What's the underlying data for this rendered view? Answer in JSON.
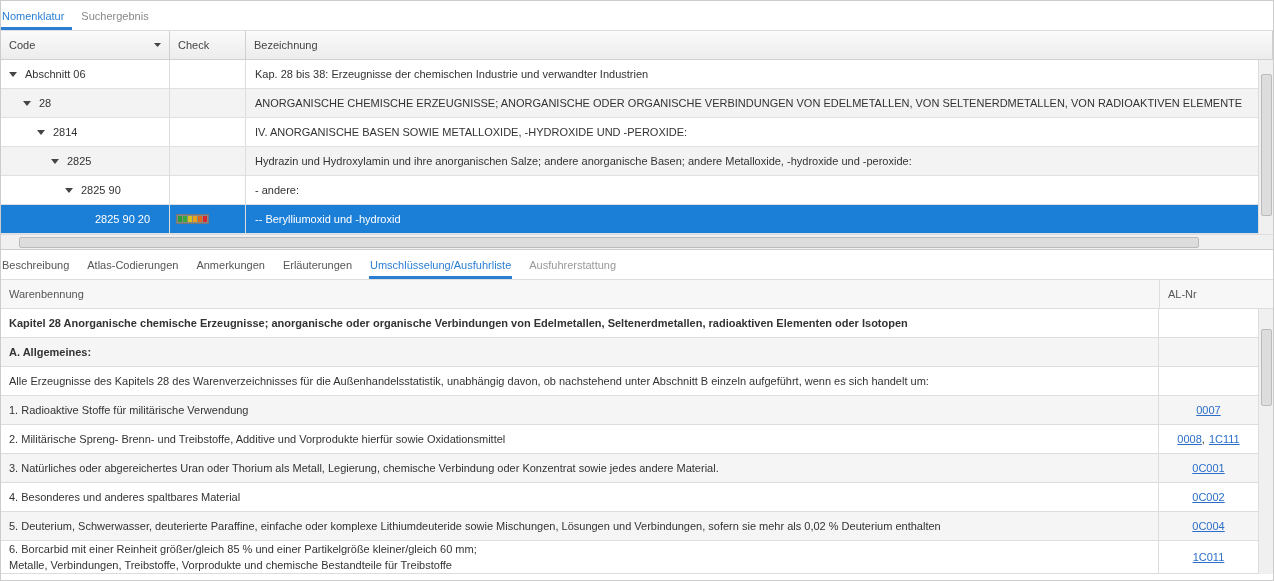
{
  "top_tabs": [
    {
      "label": "Nomenklatur",
      "selected": true
    },
    {
      "label": "Suchergebnis",
      "selected": false
    }
  ],
  "tree_columns": [
    "Code",
    "Check",
    "Bezeichnung"
  ],
  "tree": [
    {
      "code": "Abschnitt 06",
      "expanded": true,
      "selected": false,
      "description": "Kap. 28 bis 38: Erzeugnisse der chemischen Industrie und verwandter Industrien",
      "children": [
        {
          "code": "28",
          "expanded": true,
          "selected": false,
          "description": "ANORGANISCHE CHEMISCHE ERZEUGNISSE; ANORGANISCHE ODER ORGANISCHE VERBINDUNGEN VON EDELMETALLEN, VON SELTENERDMETALLEN, VON RADIOAKTIVEN ELEMENTE",
          "children": [
            {
              "code": "2814",
              "expanded": true,
              "selected": false,
              "description": "IV. ANORGANISCHE BASEN SOWIE METALLOXIDE, -HYDROXIDE UND -PEROXIDE:",
              "children": [
                {
                  "code": "2825",
                  "expanded": true,
                  "selected": false,
                  "description": "Hydrazin und Hydroxylamin und ihre anorganischen Salze; andere anorganische Basen; andere Metalloxide, -hydroxide und -peroxide:",
                  "children": [
                    {
                      "code": "2825 90",
                      "expanded": true,
                      "selected": false,
                      "description": "- andere:",
                      "children": [
                        {
                          "code": "2825 90 20",
                          "selected": true,
                          "meter": true,
                          "description": "-- Berylliumoxid und -hydroxid"
                        }
                      ]
                    }
                  ]
                }
              ]
            }
          ]
        }
      ]
    }
  ],
  "detail_tabs": [
    {
      "label": "Beschreibung",
      "selected": false,
      "disabled": false
    },
    {
      "label": "Atlas-Codierungen",
      "selected": false,
      "disabled": false
    },
    {
      "label": "Anmerkungen",
      "selected": false,
      "disabled": false
    },
    {
      "label": "Erläuterungen",
      "selected": false,
      "disabled": false
    },
    {
      "label": "Umschlüsselung/Ausfuhrliste",
      "selected": true,
      "disabled": false
    },
    {
      "label": "Ausfuhrerstattung",
      "selected": false,
      "disabled": true
    }
  ],
  "table": {
    "columns": [
      "Warenbennung",
      "AL-Nr"
    ],
    "rows": [
      {
        "kind": "heading",
        "lines": [
          "Kapitel 28 Anorganische chemische Erzeugnisse; anorganische oder organische Verbindungen von Edelmetallen, Seltenerdmetallen, radioaktiven Elementen oder Isotopen"
        ]
      },
      {
        "kind": "heading",
        "lines": [
          "A. Allgemeines:"
        ]
      },
      {
        "kind": "text",
        "lines": [
          "Alle Erzeugnisse des Kapitels 28 des Warenverzeichnisses für die Außenhandelsstatistik, unabhängig davon, ob nachstehend unter Abschnitt B einzeln aufgeführt, wenn es sich handelt um:"
        ]
      },
      {
        "kind": "text",
        "lines": [
          "1. Radioaktive Stoffe für militärische Verwendung"
        ],
        "al_nr": [
          {
            "kind": "link",
            "text": "0007"
          }
        ]
      },
      {
        "kind": "text",
        "lines": [
          "2. Militärische Spreng- Brenn- und Treibstoffe, Additive und Vorprodukte hierfür sowie Oxidationsmittel"
        ],
        "al_nr": [
          {
            "kind": "link",
            "text": "0008"
          },
          {
            "kind": "separator",
            "text": ","
          },
          {
            "kind": "link",
            "text": "1C111"
          }
        ]
      },
      {
        "kind": "text",
        "lines": [
          "3. Natürliches oder abgereichertes Uran oder Thorium als Metall, Legierung, chemische Verbindung oder Konzentrat sowie jedes andere Material."
        ],
        "al_nr": [
          {
            "kind": "link",
            "text": "0C001"
          }
        ]
      },
      {
        "kind": "text",
        "lines": [
          "4. Besonderes und anderes spaltbares Material"
        ],
        "al_nr": [
          {
            "kind": "link",
            "text": "0C002"
          }
        ]
      },
      {
        "kind": "text",
        "lines": [
          "5. Deuterium, Schwerwasser, deuterierte Paraffine, einfache oder komplexe Lithiumdeuteride sowie Mischungen, Lösungen und Verbindungen, sofern sie mehr als 0,02 % Deuterium enthalten"
        ],
        "al_nr": [
          {
            "kind": "link",
            "text": "0C004"
          }
        ]
      },
      {
        "kind": "text",
        "lines": [
          "6. Borcarbid mit einer Reinheit größer/gleich 85 % und einer Partikelgröße kleiner/gleich 60 mm;",
          "Metalle, Verbindungen, Treibstoffe, Vorprodukte und chemische Bestandteile für Treibstoffe"
        ],
        "al_nr": [
          {
            "kind": "link",
            "text": "1C011"
          }
        ]
      }
    ]
  }
}
